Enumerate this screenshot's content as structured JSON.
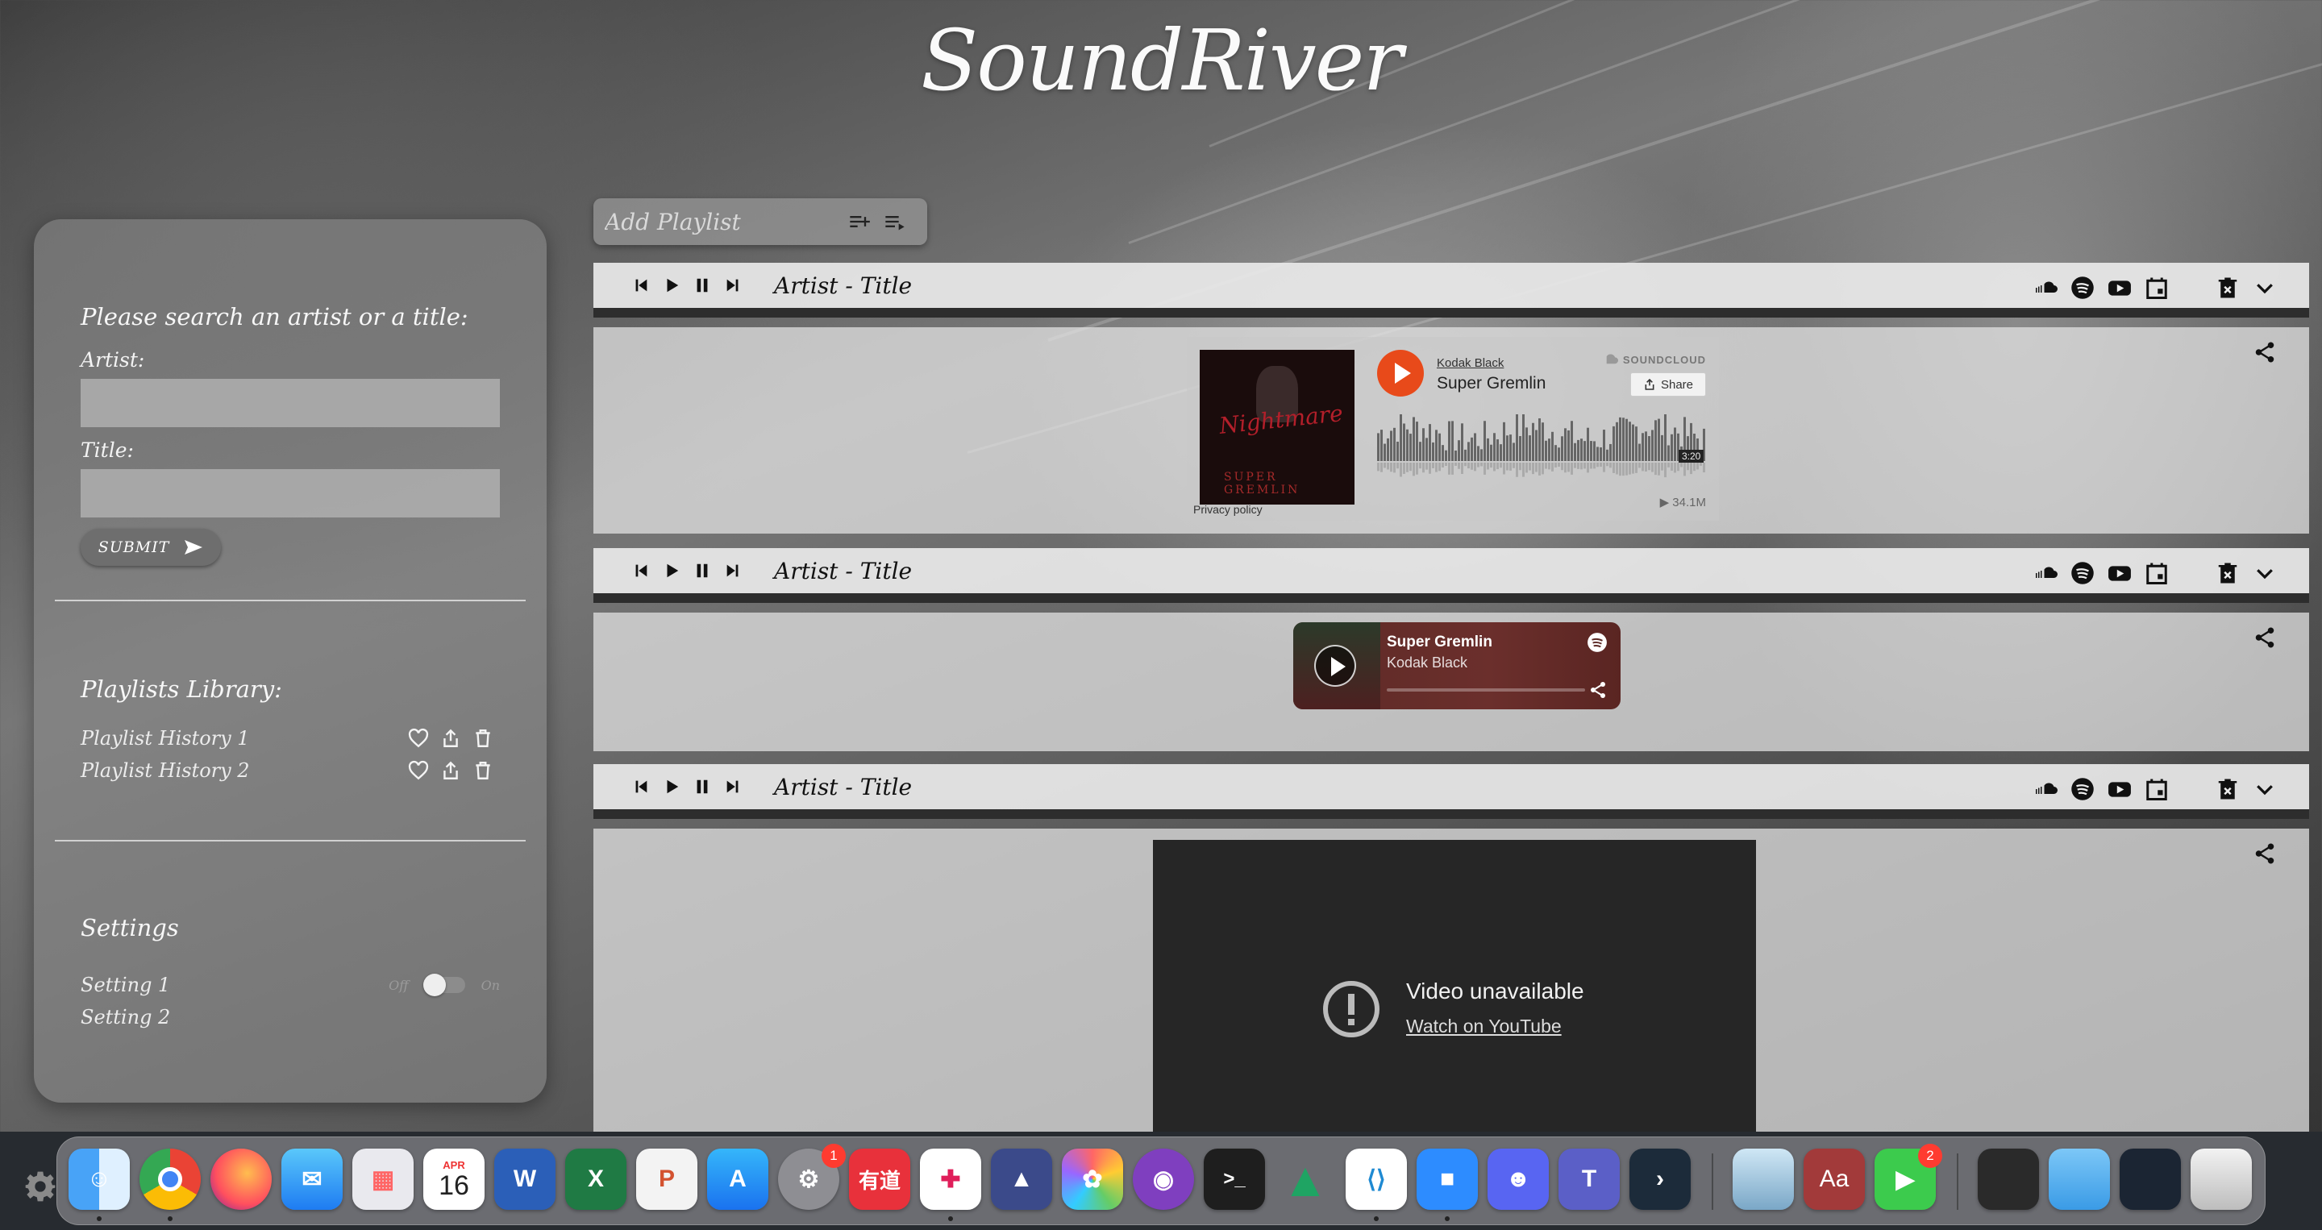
{
  "app": {
    "logo_text": "SoundRiver"
  },
  "sidebar": {
    "search_heading": "Please search an artist or a title:",
    "artist_label": "Artist:",
    "title_label": "Title:",
    "artist_value": "",
    "title_value": "",
    "submit_label": "SUBMIT",
    "library_heading": "Playlists Library:",
    "playlists": [
      {
        "name": "Playlist History 1"
      },
      {
        "name": "Playlist History 2"
      }
    ],
    "settings_heading": "Settings",
    "settings": [
      {
        "name": "Setting 1",
        "off_label": "Off",
        "on_label": "On"
      },
      {
        "name": "Setting 2"
      }
    ]
  },
  "add_playlist": {
    "placeholder": "Add Playlist"
  },
  "tracks": [
    {
      "title": "Artist - Title"
    },
    {
      "title": "Artist - Title"
    },
    {
      "title": "Artist - Title"
    }
  ],
  "soundcloud_widget": {
    "artist": "Kodak Black",
    "track": "Super Gremlin",
    "brand": "SOUNDCLOUD",
    "share_label": "Share",
    "duration": "3:20",
    "plays": "34.1M",
    "privacy": "Privacy policy",
    "accent": "#e84a1a"
  },
  "spotify_widget": {
    "title": "Super Gremlin",
    "artist": "Kodak Black"
  },
  "youtube_widget": {
    "message": "Video unavailable",
    "link": "Watch on YouTube"
  },
  "dock": {
    "calendar_month": "APR",
    "calendar_day": "16",
    "settings_badge": "1",
    "facetime_badge": "2",
    "youdao_label": "有道",
    "dictionary_label": "Aa"
  }
}
